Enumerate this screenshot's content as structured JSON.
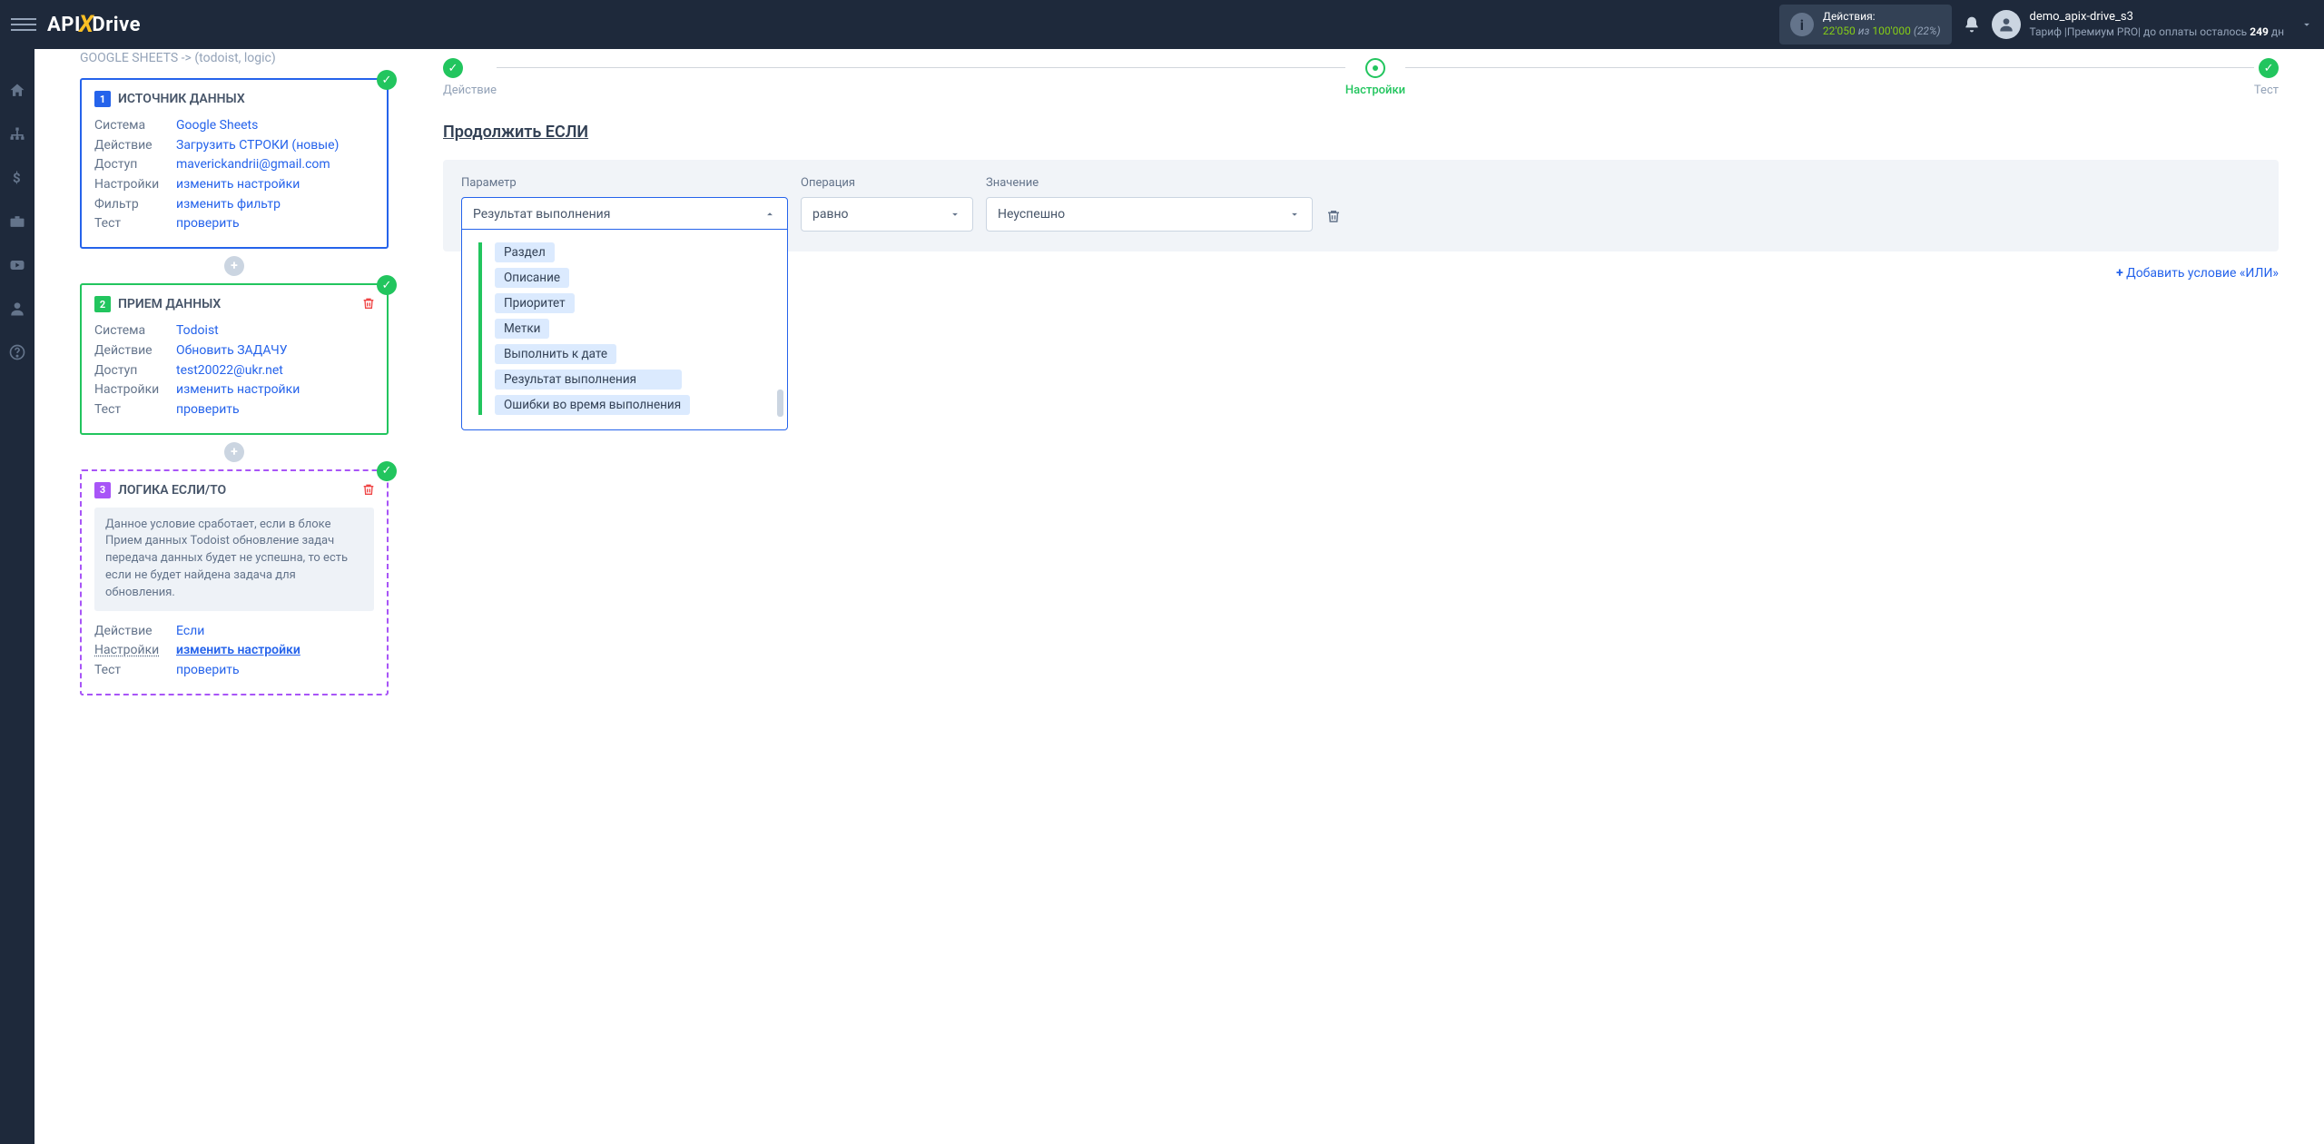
{
  "topbar": {
    "logo_api": "API",
    "logo_drive": "Drive",
    "actions_label": "Действия:",
    "actions_used": "22'050",
    "actions_sep": "из",
    "actions_total": "100'000",
    "actions_pct": "(22%)",
    "user_name": "demo_apix-drive_s3",
    "tariff_prefix": "Тариф |",
    "tariff_name": "Премиум PRO",
    "tariff_suffix": "|  до оплаты осталось",
    "days_left": "249",
    "days_unit": "дн"
  },
  "breadcrumb": "GOOGLE SHEETS -> (todoist, logic)",
  "card1": {
    "title": "ИСТОЧНИК ДАННЫХ",
    "rows": {
      "system_k": "Система",
      "system_v": "Google Sheets",
      "action_k": "Действие",
      "action_v": "Загрузить СТРОКИ (новые)",
      "access_k": "Доступ",
      "access_v": "maverickandrii@gmail.com",
      "settings_k": "Настройки",
      "settings_v": "изменить настройки",
      "filter_k": "Фильтр",
      "filter_v": "изменить фильтр",
      "test_k": "Тест",
      "test_v": "проверить"
    }
  },
  "card2": {
    "title": "ПРИЕМ ДАННЫХ",
    "rows": {
      "system_k": "Система",
      "system_v": "Todoist",
      "action_k": "Действие",
      "action_v": "Обновить ЗАДАЧУ",
      "access_k": "Доступ",
      "access_v": "test20022@ukr.net",
      "settings_k": "Настройки",
      "settings_v": "изменить настройки",
      "test_k": "Тест",
      "test_v": "проверить"
    }
  },
  "card3": {
    "title": "ЛОГИКА ЕСЛИ/ТО",
    "note": "Данное условие сработает, если в блоке Прием данных Todoist обновление задач передача данных будет не успешна, то есть если не будет найдена задача для обновления.",
    "rows": {
      "action_k": "Действие",
      "action_v": "Если",
      "settings_k": "Настройки",
      "settings_v": "изменить настройки",
      "test_k": "Тест",
      "test_v": "проверить"
    }
  },
  "stepper": {
    "s1": "Действие",
    "s2": "Настройки",
    "s3": "Тест"
  },
  "section_title": "Продолжить ЕСЛИ",
  "cond": {
    "param_label": "Параметр",
    "param_value": "Результат выполнения",
    "op_label": "Операция",
    "op_value": "равно",
    "val_label": "Значение",
    "val_value": "Неуспешно"
  },
  "dropdown": {
    "opt1": "Раздел",
    "opt2": "Описание",
    "opt3": "Приоритет",
    "opt4": "Метки",
    "opt5": "Выполнить к дате",
    "opt6": "Результат выполнения",
    "opt7": "Ошибки во время выполнения"
  },
  "add_or": "Добавить условие «ИЛИ»"
}
